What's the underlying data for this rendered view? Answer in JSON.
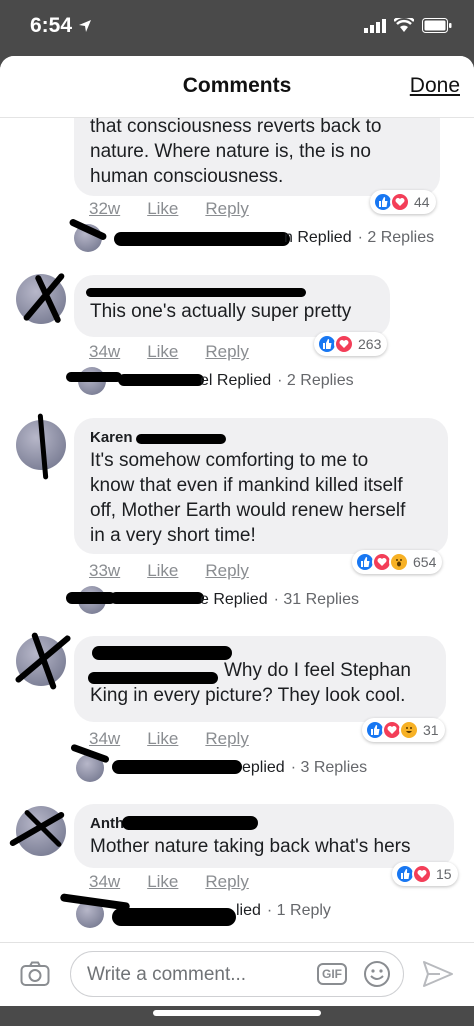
{
  "status": {
    "time": "6:54"
  },
  "header": {
    "title": "Comments",
    "done": "Done"
  },
  "comments": [
    {
      "author": "",
      "text_lines": [
        "that consciousness reverts back to",
        "nature. Where nature is, the is no",
        "human consciousness."
      ],
      "time": "32w",
      "like": "Like",
      "reply": "Reply",
      "reaction_count": "44",
      "replied_text": "n Replied",
      "replies_count": "· 2 Replies"
    },
    {
      "author": "",
      "text_lines": [
        "This one's actually super pretty"
      ],
      "time": "34w",
      "like": "Like",
      "reply": "Reply",
      "reaction_count": "263",
      "replied_text": "el Replied",
      "replies_count": "· 2 Replies"
    },
    {
      "author": "Karen",
      "text_lines": [
        "It's somehow comforting to me to",
        "know that even if mankind killed itself",
        "off, Mother Earth would renew herself",
        "in a very short time!"
      ],
      "time": "33w",
      "like": "Like",
      "reply": "Reply",
      "reaction_count": "654",
      "replied_text": "e Replied",
      "replies_count": "· 31 Replies"
    },
    {
      "author": "",
      "text_lines": [
        "Why do I feel Stephan",
        "King in every picture? They look cool."
      ],
      "time": "34w",
      "like": "Like",
      "reply": "Reply",
      "reaction_count": "31",
      "replied_text": "eplied",
      "replies_count": "· 3 Replies"
    },
    {
      "author": "Anth",
      "text_lines": [
        "Mother nature taking back what's hers"
      ],
      "time": "34w",
      "like": "Like",
      "reply": "Reply",
      "reaction_count": "15",
      "replied_text": "lied",
      "replies_count": "· 1 Reply"
    }
  ],
  "composer": {
    "placeholder": "Write a comment...",
    "gif": "GIF"
  },
  "colors": {
    "like": "#1877f2",
    "love": "#f33e58",
    "haha": "#f7b125",
    "bubble": "#f0f0f2"
  },
  "icons": [
    "location-arrow-icon",
    "signal-icon",
    "wifi-icon",
    "battery-icon",
    "like-reaction-icon",
    "love-reaction-icon",
    "haha-reaction-icon",
    "camera-icon",
    "gif-icon",
    "emoji-icon",
    "send-icon"
  ]
}
